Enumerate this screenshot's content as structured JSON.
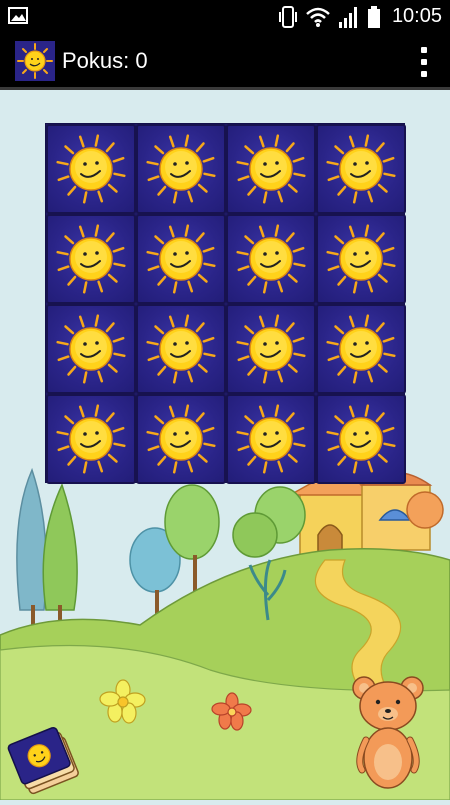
{
  "status_bar": {
    "time": "10:05",
    "icons": [
      "picture-icon",
      "vibrate-icon",
      "wifi-icon",
      "signal-icon",
      "battery-icon"
    ]
  },
  "action_bar": {
    "title": "Pokus: 0",
    "app_icon": "sun-card-icon",
    "menu_icon": "overflow-menu-icon"
  },
  "board": {
    "rows": 4,
    "cols": 4,
    "cards": [
      {
        "state": "face-down",
        "back_icon": "sun-icon"
      },
      {
        "state": "face-down",
        "back_icon": "sun-icon"
      },
      {
        "state": "face-down",
        "back_icon": "sun-icon"
      },
      {
        "state": "face-down",
        "back_icon": "sun-icon"
      },
      {
        "state": "face-down",
        "back_icon": "sun-icon"
      },
      {
        "state": "face-down",
        "back_icon": "sun-icon"
      },
      {
        "state": "face-down",
        "back_icon": "sun-icon"
      },
      {
        "state": "face-down",
        "back_icon": "sun-icon"
      },
      {
        "state": "face-down",
        "back_icon": "sun-icon"
      },
      {
        "state": "face-down",
        "back_icon": "sun-icon"
      },
      {
        "state": "face-down",
        "back_icon": "sun-icon"
      },
      {
        "state": "face-down",
        "back_icon": "sun-icon"
      },
      {
        "state": "face-down",
        "back_icon": "sun-icon"
      },
      {
        "state": "face-down",
        "back_icon": "sun-icon"
      },
      {
        "state": "face-down",
        "back_icon": "sun-icon"
      },
      {
        "state": "face-down",
        "back_icon": "sun-icon"
      }
    ]
  },
  "colors": {
    "status_bar": "#000000",
    "sky": "#d8ebee",
    "card_back": "#2a2488",
    "sun": "#ffd21a",
    "grass": "#9cc94e"
  }
}
